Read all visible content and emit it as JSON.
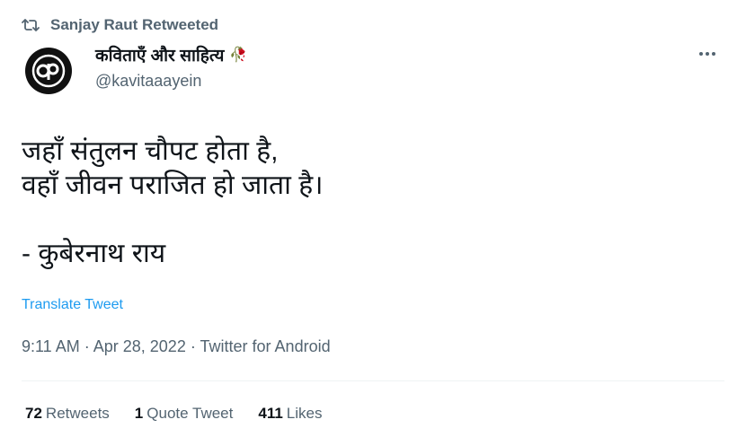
{
  "retweet_header": {
    "icon": "retweet-icon",
    "text": "Sanjay Raut Retweeted"
  },
  "author": {
    "avatar_icon": "kavitaaayein-logo",
    "name": "कविताएँ और साहित्य",
    "name_emoji": "🥀",
    "handle": "@kavitaaayein"
  },
  "more_icon": "more-options-icon",
  "tweet": {
    "text": "जहाँ संतुलन चौपट होता है,\nवहाँ जीवन पराजित हो जाता है।\n\n- कुबेरनाथ राय",
    "translate_label": "Translate Tweet",
    "time": "9:11 AM",
    "separator": "·",
    "date": "Apr 28, 2022",
    "source": "Twitter for Android"
  },
  "stats": {
    "retweets_count": "72",
    "retweets_label": "Retweets",
    "quotes_count": "1",
    "quotes_label": "Quote Tweet",
    "likes_count": "411",
    "likes_label": "Likes"
  },
  "colors": {
    "link": "#1d9bf0",
    "secondary_text": "#536471",
    "primary_text": "#0f1419"
  }
}
